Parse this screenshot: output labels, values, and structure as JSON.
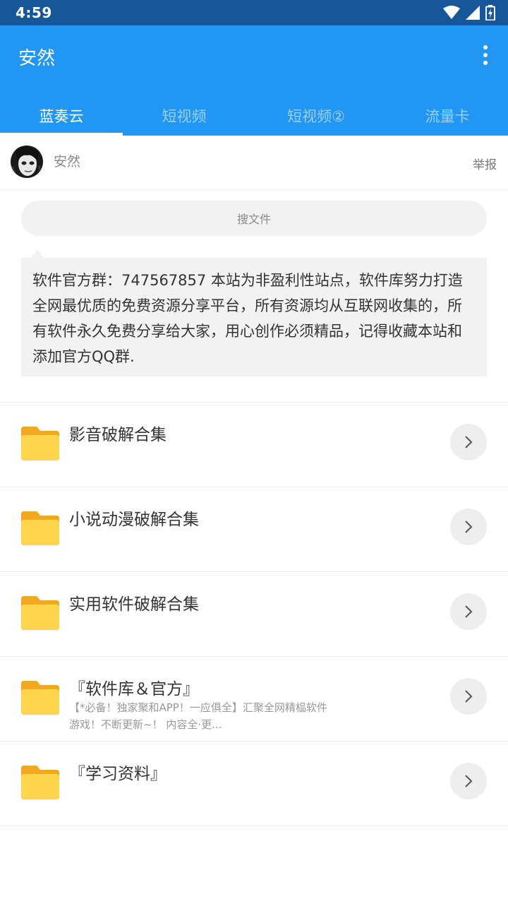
{
  "status_bar": {
    "time": "4:59",
    "icons": [
      "wifi-icon",
      "signal-icon",
      "battery-charging-icon"
    ]
  },
  "app_bar": {
    "title": "安然",
    "menu_icon": "more-vert-icon"
  },
  "tabs": [
    {
      "label": "蓝奏云",
      "active": true
    },
    {
      "label": "短视频",
      "active": false
    },
    {
      "label": "短视频②",
      "active": false
    },
    {
      "label": "流量卡",
      "active": false
    }
  ],
  "profile": {
    "name": "安然",
    "report_label": "举报"
  },
  "search": {
    "placeholder": "搜文件"
  },
  "notice": {
    "text": "软件官方群：747567857 本站为非盈利性站点，软件库努力打造全网最优质的免费资源分享平台，所有资源均从互联网收集的，所有软件永久免费分享给大家，用心创作必须精品，记得收藏本站和添加官方QQ群."
  },
  "folders": [
    {
      "title": "影音破解合集",
      "description": ""
    },
    {
      "title": "小说动漫破解合集",
      "description": ""
    },
    {
      "title": "实用软件破解合集",
      "description": ""
    },
    {
      "title": "『软件库＆官方』",
      "description": "【*必备！独家聚和APP！一应俱全】汇聚全网精榀软件 游戏！不断更新~！ 内容全·更..."
    },
    {
      "title": "『学习资料』",
      "description": ""
    }
  ],
  "colors": {
    "status_bar": "#155799",
    "app_bar": "#2196f3",
    "folder_back": "#f5a623",
    "folder_front": "#ffd54f"
  }
}
